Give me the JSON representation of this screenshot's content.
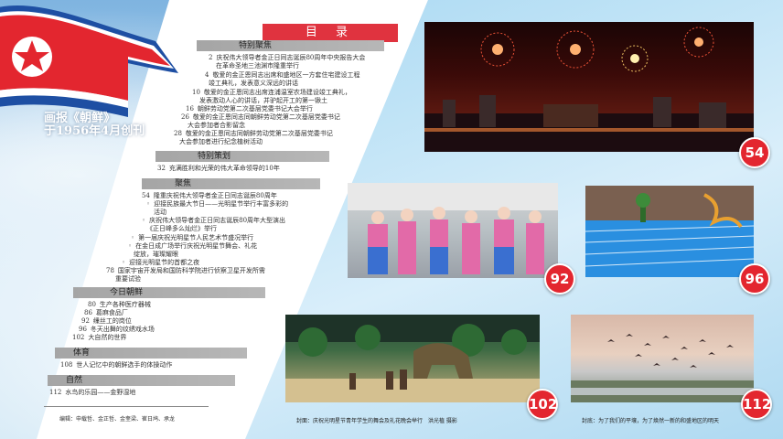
{
  "magazine": {
    "title_line1": "画报《朝鲜》",
    "title_line2": "于1956年4月创刊"
  },
  "toc": {
    "heading": "目 录",
    "sections": [
      {
        "name": "特别聚焦",
        "entries": [
          {
            "page": "2",
            "lines": [
              "庆祝伟大领导者金正日同志诞辰80周年中央报告大会",
              "在革命圣地三池渊市隆重举行"
            ]
          },
          {
            "page": "4",
            "lines": [
              "敬爱的金正恩同志出席和盛地区一方套住宅建设工程",
              "竣工典礼，发表意义深远的讲话"
            ]
          },
          {
            "page": "10",
            "lines": [
              "敬爱的金正恩同志出席连浦温室农场建设竣工典礼，",
              "发表激动人心的讲话，并驴起开工的第一锹土"
            ]
          },
          {
            "page": "16",
            "lines": [
              "朝鲜劳动党第二次基层党委书记大会举行"
            ]
          },
          {
            "page": "26",
            "lines": [
              "敬爱的金正恩同志同朝鲜劳动党第二次基层党委书记",
              "大会参加者合影留念"
            ]
          },
          {
            "page": "28",
            "lines": [
              "敬爱的金正恩同志同朝鲜劳动党第二次基层党委书记",
              "大会参加者进行纪念植树活动"
            ]
          }
        ]
      },
      {
        "name": "特别策划",
        "entries": [
          {
            "page": "32",
            "lines": [
              "充满胜利和光荣的伟大革命领导的10年"
            ]
          }
        ]
      },
      {
        "name": "聚焦",
        "entries": [
          {
            "page": "54",
            "lines": [
              "隆重庆祝伟大领导者金正日同志诞辰80周年"
            ]
          },
          {
            "page": "◦",
            "lines": [
              "迎接民族最大节日——光明星节举行丰富多彩的",
              "活动"
            ]
          },
          {
            "page": "◦",
            "lines": [
              "庆祝伟大领导者金正日同志诞辰80周年大型演出",
              "《正日峰多么灿烂》举行"
            ]
          },
          {
            "page": "◦",
            "lines": [
              "第一届庆祝光明星节人民艺术节盛况举行"
            ]
          },
          {
            "page": "◦",
            "lines": [
              "在金日成广场举行庆祝光明星节舞会、礼花",
              "绽放，璀璨耀眼"
            ]
          },
          {
            "page": "◦",
            "lines": [
              "迎接光明星节的首都之夜"
            ]
          },
          {
            "page": "78",
            "lines": [
              "国家宇宙开发局和国防科学院进行侦察卫星开发所需",
              "重要试验"
            ]
          }
        ]
      },
      {
        "name": "今日朝鲜",
        "entries": [
          {
            "page": "80",
            "lines": [
              "生产各种医疗器械"
            ]
          },
          {
            "page": "86",
            "lines": [
              "葛麻食品厂"
            ]
          },
          {
            "page": "92",
            "lines": [
              "缫丝工的岗位"
            ]
          },
          {
            "page": "96",
            "lines": [
              "冬天出舞的纹绣戏水场"
            ]
          },
          {
            "page": "102",
            "lines": [
              "大自然的世界"
            ]
          }
        ]
      },
      {
        "name": "体育",
        "entries": [
          {
            "page": "108",
            "lines": [
              "世人记忆中的朝鲜选手的体操动作"
            ]
          }
        ]
      },
      {
        "name": "自然",
        "entries": [
          {
            "page": "112",
            "lines": [
              "水鸟的乐园——金野湿地"
            ]
          }
        ]
      }
    ]
  },
  "editors": "编辑：申载哲、金正哲、金奎梁、崔日鸠、承龙",
  "photos": [
    {
      "badge": "54",
      "icon": "fireworks-photo"
    },
    {
      "badge": "92",
      "icon": "workers-photo"
    },
    {
      "badge": "96",
      "icon": "pool-photo"
    },
    {
      "badge": "102",
      "icon": "dinosaur-park-photo"
    },
    {
      "badge": "112",
      "icon": "wetland-birds-photo"
    }
  ],
  "captions": {
    "cover_front": "封面：庆祝光明星节青年学生的舞会及礼花晚会举行　洪光植 摄影",
    "cover_back": "封底：为了我们的平壤，为了焕然一新的和盛地区的明天"
  },
  "colors": {
    "accent_red": "#e3262f",
    "section_gray": "#a5a5a5",
    "flag_blue": "#1e4fa3"
  }
}
